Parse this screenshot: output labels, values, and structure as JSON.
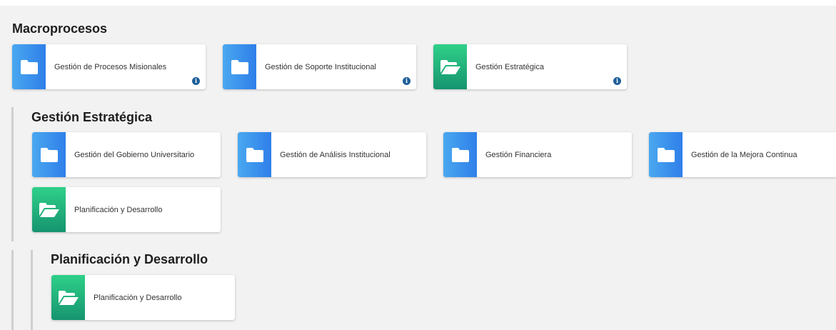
{
  "macroprocesos": {
    "title": "Macroprocesos",
    "cards": [
      {
        "label": "Gestión de Procesos Misionales",
        "icon": "folder-icon",
        "color": "blue",
        "info": "i"
      },
      {
        "label": "Gestión de Soporte Institucional",
        "icon": "folder-icon",
        "color": "blue",
        "info": "i"
      },
      {
        "label": "Gestión Estratégica",
        "icon": "folder-open-icon",
        "color": "green",
        "info": "i"
      }
    ]
  },
  "gestion_estrategica": {
    "title": "Gestión Estratégica",
    "cards": [
      {
        "label": "Gestión del Gobierno Universitario",
        "icon": "folder-icon",
        "color": "blue"
      },
      {
        "label": "Gestión de Análisis Institucional",
        "icon": "folder-icon",
        "color": "blue"
      },
      {
        "label": "Gestión Financiera",
        "icon": "folder-icon",
        "color": "blue"
      },
      {
        "label": "Gestión de la Mejora Continua",
        "icon": "folder-icon",
        "color": "blue"
      },
      {
        "label": "Planificación y Desarrollo",
        "icon": "folder-open-icon",
        "color": "green"
      }
    ]
  },
  "planificacion": {
    "title": "Planificación y Desarrollo",
    "cards": [
      {
        "label": "Planificación y Desarrollo",
        "icon": "folder-open-icon",
        "color": "green"
      }
    ]
  },
  "colors": {
    "blue_tile": "#2f7fe9",
    "green_tile": "#16946f",
    "info_badge": "#1f5f9a",
    "background": "#f2f2f2"
  }
}
